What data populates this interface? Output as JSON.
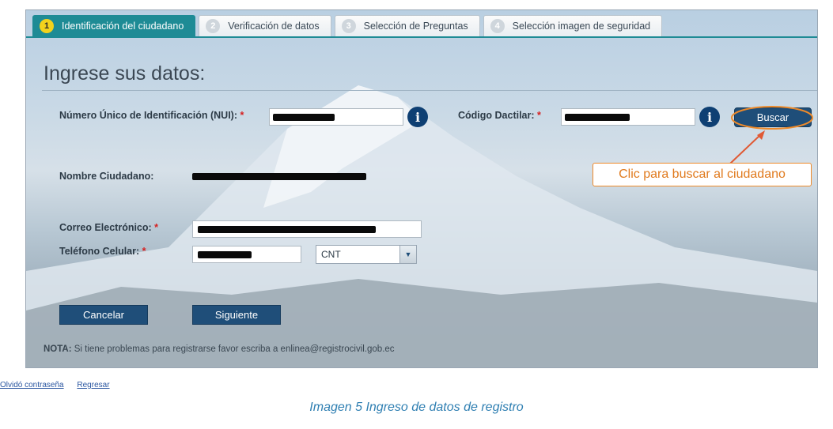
{
  "tabs": [
    {
      "num": "1",
      "label": "Identificación del ciudadano",
      "active": true
    },
    {
      "num": "2",
      "label": "Verificación de datos",
      "active": false
    },
    {
      "num": "3",
      "label": "Selección de Preguntas",
      "active": false
    },
    {
      "num": "4",
      "label": "Selección imagen de seguridad",
      "active": false
    }
  ],
  "page_title": "Ingrese sus datos:",
  "form": {
    "nui_label": "Número Único de Identificación (NUI):",
    "dactilar_label": "Código Dactilar:",
    "required_mark": "*",
    "info_glyph": "i",
    "search_button": "Buscar",
    "nombre_label": "Nombre Ciudadano:",
    "email_label": "Correo Electrónico:",
    "phone_label": "Teléfono Celular:",
    "operator_selected": "CNT"
  },
  "callout": "Clic para buscar al ciudadano",
  "buttons": {
    "cancel": "Cancelar",
    "next": "Siguiente"
  },
  "note": {
    "prefix": "NOTA:",
    "text": " Si tiene problemas para registrarse favor escriba a enlinea@registrocivil.gob.ec"
  },
  "footer": {
    "forgot": "Olvidó contraseña",
    "back": "Regresar"
  },
  "caption": "Imagen 5   Ingreso de datos de registro",
  "colors": {
    "tab_active": "#1e8b95",
    "button": "#1f4e79",
    "callout": "#ee8a2a",
    "required": "#d62020"
  }
}
